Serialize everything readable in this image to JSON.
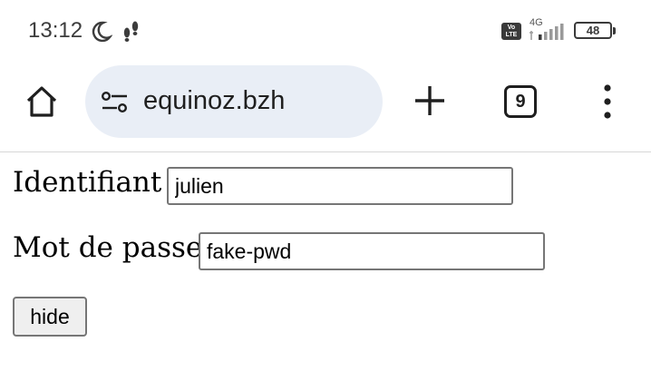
{
  "status_bar": {
    "time": "13:12",
    "network_type": "4G",
    "volte_label": "Vo LTE",
    "battery_level": "48",
    "icons": [
      "moon-icon",
      "footsteps-icon",
      "volte-icon",
      "signal-icon",
      "battery-icon"
    ]
  },
  "toolbar": {
    "url": "equinoz.bzh",
    "tab_count": "9",
    "icons": [
      "home-icon",
      "site-settings-icon",
      "new-tab-icon",
      "tabs-icon",
      "more-menu-icon"
    ]
  },
  "form": {
    "username_label": "Identifiant",
    "username_value": "julien",
    "password_label": "Mot de passe",
    "password_value": "fake-pwd",
    "hide_button_label": "hide"
  }
}
